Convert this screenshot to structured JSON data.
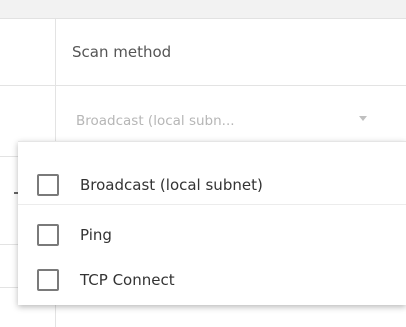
{
  "table": {
    "column_header": "Scan method",
    "select": {
      "value": "Broadcast (local subn...",
      "caret_icon": "caret-down-icon"
    }
  },
  "dropdown": {
    "options": [
      {
        "label": "Broadcast (local subnet)",
        "checked": false
      },
      {
        "label": "Ping",
        "checked": false
      },
      {
        "label": "TCP Connect",
        "checked": false
      }
    ]
  }
}
